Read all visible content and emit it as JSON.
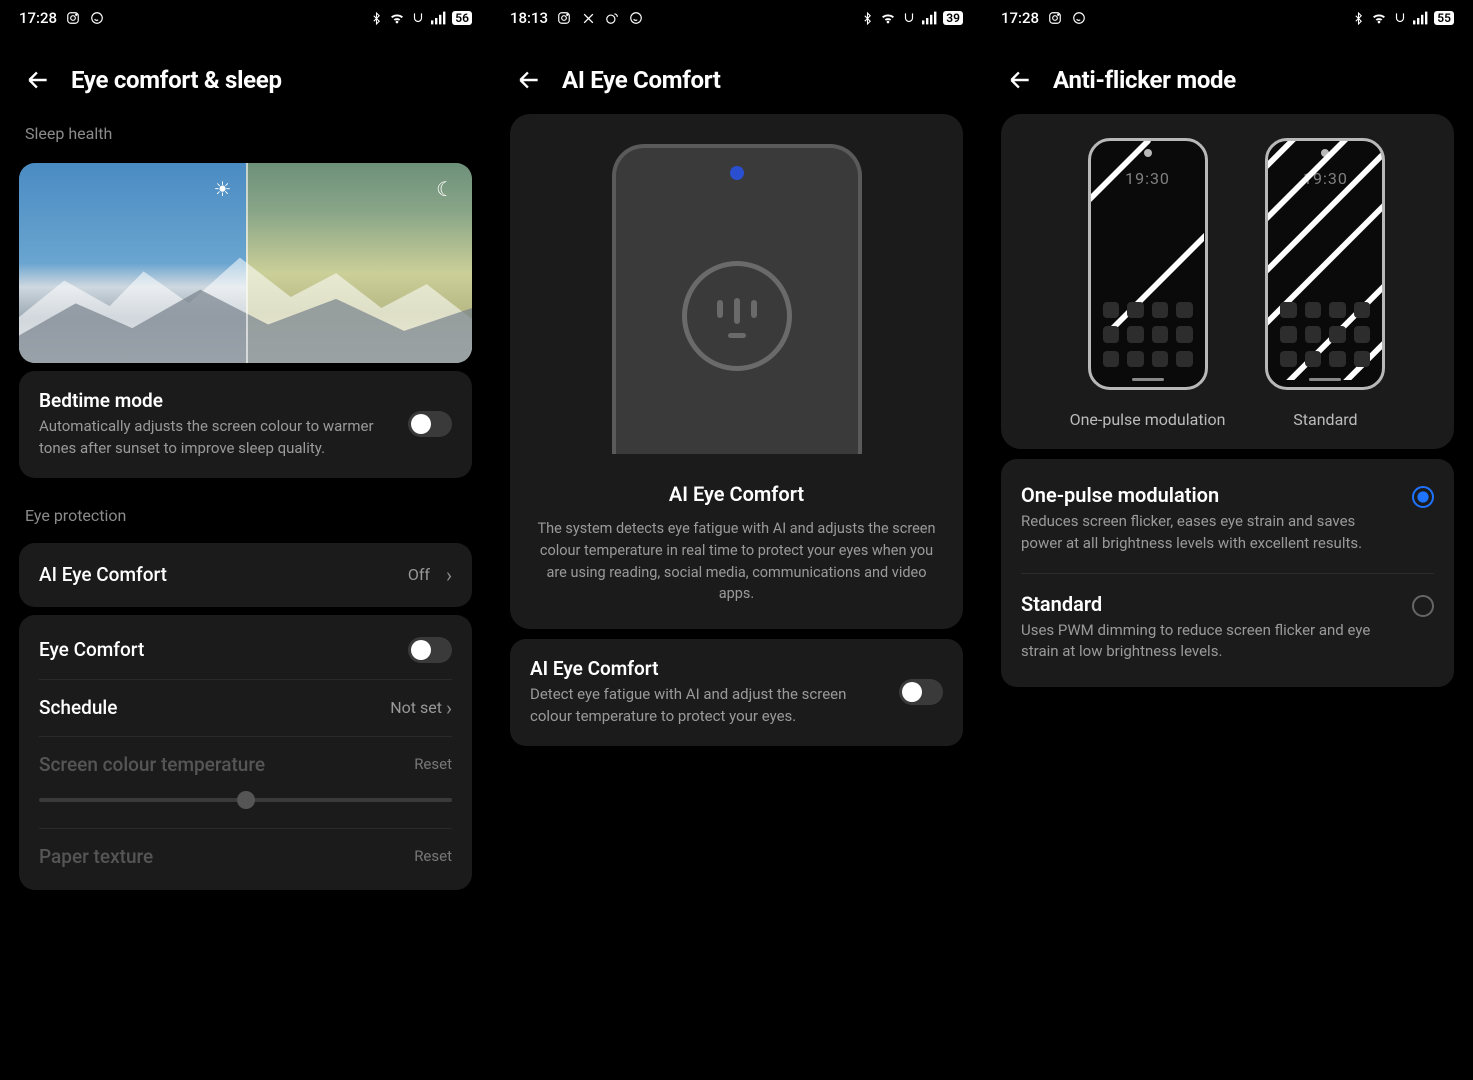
{
  "pane1": {
    "status": {
      "time": "17:28",
      "battery": "56"
    },
    "title": "Eye comfort & sleep",
    "section_sleep": "Sleep health",
    "bedtime": {
      "title": "Bedtime mode",
      "desc": "Automatically adjusts the screen colour to warmer tones after sunset to improve sleep quality."
    },
    "section_eye": "Eye protection",
    "ai_eye_row": {
      "title": "AI Eye Comfort",
      "value": "Off"
    },
    "eye_comfort": "Eye Comfort",
    "schedule": {
      "title": "Schedule",
      "value": "Not set"
    },
    "sct": {
      "title": "Screen colour temperature",
      "reset": "Reset"
    },
    "paper": {
      "title": "Paper texture",
      "reset": "Reset"
    }
  },
  "pane2": {
    "status": {
      "time": "18:13",
      "battery": "39"
    },
    "title": "AI Eye Comfort",
    "hero_title": "AI Eye Comfort",
    "hero_desc": "The system detects eye fatigue with AI and adjusts the screen colour temperature in real time to protect your eyes when you are using reading, social media, communications and video apps.",
    "toggle": {
      "title": "AI Eye Comfort",
      "desc": "Detect eye fatigue with AI and adjust the screen colour temperature to protect your eyes."
    }
  },
  "pane3": {
    "status": {
      "time": "17:28",
      "battery": "55"
    },
    "title": "Anti-flicker mode",
    "preview_time": "19:30",
    "label_one_pulse": "One-pulse modulation",
    "label_standard": "Standard",
    "opt1": {
      "title": "One-pulse modulation",
      "desc": "Reduces screen flicker, eases eye strain and saves power at all brightness levels with excellent results."
    },
    "opt2": {
      "title": "Standard",
      "desc": "Uses PWM dimming to reduce screen flicker and eye strain at low brightness levels."
    }
  }
}
